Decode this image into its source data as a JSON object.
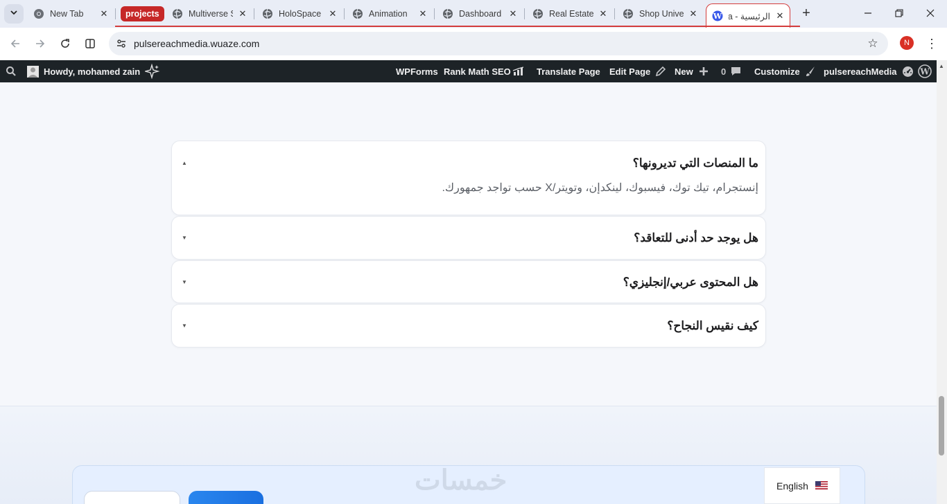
{
  "browser": {
    "tabs": [
      {
        "title": "New Tab",
        "favicon": "chrome-icon"
      },
      {
        "title": "Multiverse S",
        "favicon": "globe-icon"
      },
      {
        "title": "HoloSpace",
        "favicon": "globe-icon"
      },
      {
        "title": "Animation",
        "favicon": "globe-icon"
      },
      {
        "title": "Dashboard",
        "favicon": "globe-icon"
      },
      {
        "title": "Real Estate",
        "favicon": "globe-icon"
      },
      {
        "title": "Shop Unive",
        "favicon": "globe-icon"
      },
      {
        "title": "الرئيسية - a",
        "favicon": "wordpress-icon"
      }
    ],
    "tab_group_label": "projects",
    "group_color": "#c62828",
    "new_tab_label": "+",
    "address_url": "pulsereachmedia.wuaze.com",
    "profile_initial": "N"
  },
  "adminbar": {
    "howdy": "Howdy, mohamed zain",
    "wpforms": "WPForms",
    "rank_math": "Rank Math SEO",
    "translate": "Translate Page",
    "edit_page": "Edit Page",
    "new": "New",
    "comments_count": "0",
    "customize": "Customize",
    "site_name": "pulsereachMedia",
    "background": "#1d2327"
  },
  "faq": {
    "items": [
      {
        "question": "ما المنصات التي تديرونها؟",
        "answer": "إنستجرام، تيك توك، فيسبوك، لينكدإن، وتويتر/X حسب تواجد جمهورك.",
        "expanded": true
      },
      {
        "question": "هل يوجد حد أدنى للتعاقد؟",
        "expanded": false
      },
      {
        "question": "هل المحتوى عربي/إنجليزي؟",
        "expanded": false
      },
      {
        "question": "كيف نقيس النجاح؟",
        "expanded": false
      }
    ],
    "caret_open": "▲",
    "caret_closed": "▼"
  },
  "footer": {
    "watermark": "خمسات",
    "language": "English",
    "accent": "#1a6fe0"
  }
}
